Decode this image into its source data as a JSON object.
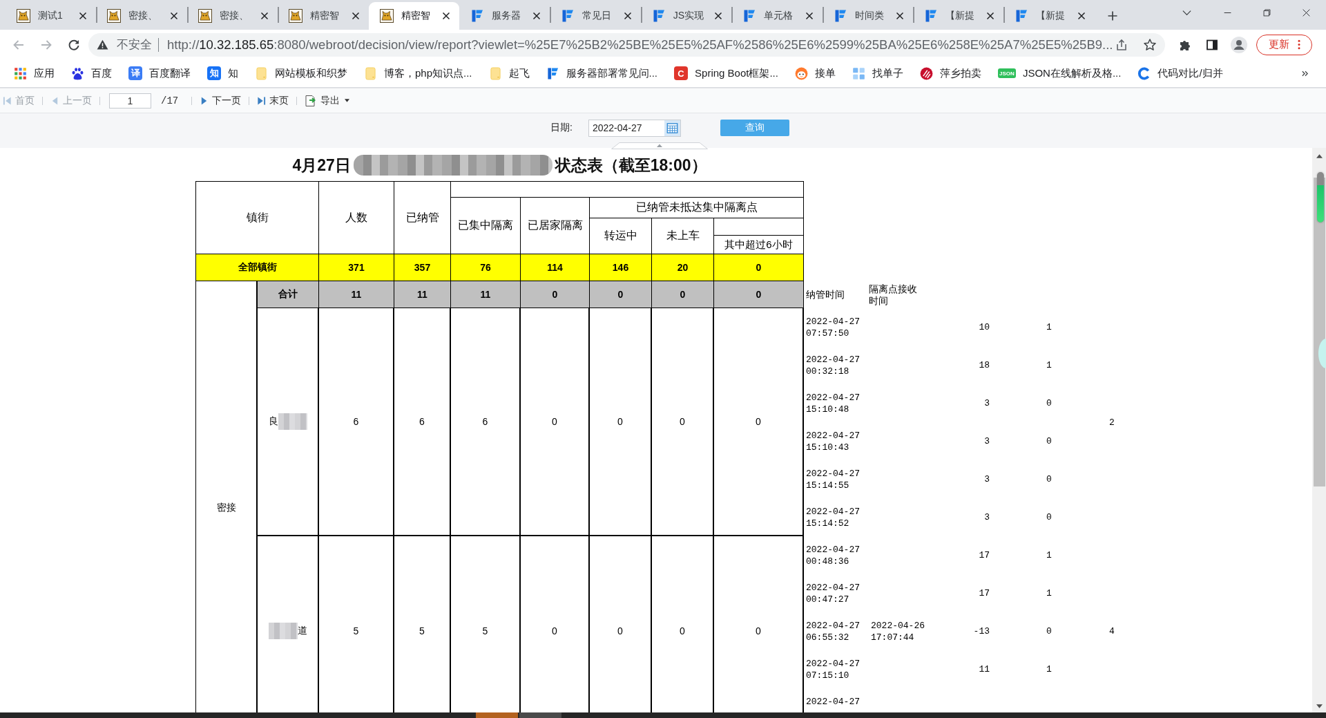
{
  "browser": {
    "tabs": [
      {
        "kind": "cat",
        "title": "测试1",
        "selected": false
      },
      {
        "kind": "cat",
        "title": "密接、",
        "selected": false
      },
      {
        "kind": "cat",
        "title": "密接、",
        "selected": false
      },
      {
        "kind": "cat",
        "title": "精密智",
        "selected": false
      },
      {
        "kind": "cat",
        "title": "精密智",
        "selected": true
      },
      {
        "kind": "report",
        "title": "服务器",
        "selected": false
      },
      {
        "kind": "report",
        "title": "常见日",
        "selected": false
      },
      {
        "kind": "report",
        "title": "JS实现",
        "selected": false
      },
      {
        "kind": "report",
        "title": "单元格",
        "selected": false
      },
      {
        "kind": "report",
        "title": "时间类",
        "selected": false
      },
      {
        "kind": "report",
        "title": "【新提",
        "selected": false
      },
      {
        "kind": "report",
        "title": "【新提",
        "selected": false
      }
    ],
    "nav": {
      "back_disabled": true,
      "forward_disabled": true
    },
    "address": {
      "security_label": "不安全",
      "url_scheme": "http://",
      "url_host": "10.32.185.65",
      "url_rest": ":8080/webroot/decision/view/report?viewlet=%25E7%25B2%25BE%25E5%25AF%2586%25E6%2599%25BA%25E6%258E%25A7%25E5%25B9..."
    },
    "update_button": "更新",
    "bookmarks": [
      {
        "kind": "apps",
        "label": "应用"
      },
      {
        "kind": "paw",
        "label": "百度"
      },
      {
        "kind": "letter",
        "badge": "译",
        "color": "#3b7cf5",
        "label": "百度翻译"
      },
      {
        "kind": "letter",
        "badge": "知",
        "color": "#1772f6",
        "label": "知"
      },
      {
        "kind": "folder",
        "label": "网站模板和织梦"
      },
      {
        "kind": "folder",
        "label": "博客，php知识点..."
      },
      {
        "kind": "folder",
        "label": "起飞"
      },
      {
        "kind": "logo",
        "label": "服务器部署常见问..."
      },
      {
        "kind": "letter",
        "badge": "C",
        "color": "#e0352b",
        "label": "Spring Boot框架..."
      },
      {
        "kind": "face",
        "label": "接单"
      },
      {
        "kind": "tiles",
        "label": "找单子"
      },
      {
        "kind": "stripes",
        "label": "萍乡拍卖"
      },
      {
        "kind": "tag",
        "badge": "JSON",
        "label": "JSON在线解析及格..."
      },
      {
        "kind": "ring",
        "label": "代码对比/归并"
      }
    ]
  },
  "report_toolbar": {
    "nav_before": [
      {
        "kind": "first",
        "label": "首页",
        "disabled": true
      },
      {
        "kind": "prev",
        "label": "上一页",
        "disabled": true
      }
    ],
    "page_field": {
      "value": "1"
    },
    "page_total": "/17",
    "nav_after": [
      {
        "kind": "next",
        "label": "下一页",
        "disabled": false
      },
      {
        "kind": "last",
        "label": "末页",
        "disabled": false
      },
      {
        "kind": "export",
        "label": "导出",
        "disabled": false
      }
    ]
  },
  "parameters": {
    "date_label": "日期:",
    "date_value": "2022-04-27",
    "query_button": "查询"
  },
  "report": {
    "title_start": "4月27日",
    "title_end": "状态表（截至18:00）",
    "header": {
      "district": "镇街",
      "people": "人数",
      "managed": "已纳管",
      "centralized": "已集中隔离",
      "home": "已居家隔离",
      "not_arrived": "已纳管未抵达集中隔离点",
      "in_transit": "转运中",
      "not_boarded": "未上车",
      "over_6h": "其中超过6小时"
    },
    "total_row": {
      "label": "全部镇街",
      "values": [
        "371",
        "357",
        "76",
        "114",
        "146",
        "20",
        "0"
      ]
    },
    "group": {
      "label": "密接",
      "subtotal": {
        "label": "合计",
        "values": [
          "11",
          "11",
          "11",
          "0",
          "0",
          "0",
          "0"
        ]
      },
      "side_header": {
        "managed_time": "纳管时间",
        "received_time": "隔离点接收时间"
      },
      "streets": [
        {
          "name_start": "良",
          "values": [
            "6",
            "6",
            "6",
            "0",
            "0",
            "0",
            "0"
          ],
          "column_5": "2",
          "records": [
            {
              "managed_time": "2022-04-27 07:57:50",
              "column_3": "10",
              "column_4": "1"
            },
            {
              "managed_time": "2022-04-27 00:32:18",
              "column_3": "18",
              "column_4": "1"
            },
            {
              "managed_time": "2022-04-27 15:10:48",
              "column_3": "3",
              "column_4": "0"
            },
            {
              "managed_time": "2022-04-27 15:10:43",
              "column_3": "3",
              "column_4": "0"
            },
            {
              "managed_time": "2022-04-27 15:14:55",
              "column_3": "3",
              "column_4": "0"
            },
            {
              "managed_time": "2022-04-27 15:14:52",
              "column_3": "3",
              "column_4": "0"
            }
          ]
        },
        {
          "name_end": "道",
          "values": [
            "5",
            "5",
            "5",
            "0",
            "0",
            "0",
            "0"
          ],
          "column_5": "4",
          "records": [
            {
              "managed_time": "2022-04-27 00:48:36",
              "column_3": "17",
              "column_4": "1"
            },
            {
              "managed_time": "2022-04-27 00:47:27",
              "column_3": "17",
              "column_4": "1"
            },
            {
              "managed_time": "2022-04-27 06:55:32",
              "received_time": "2022-04-26 17:07:44",
              "column_3": "-13",
              "column_4": "0"
            },
            {
              "managed_time": "2022-04-27 07:15:10",
              "column_3": "11",
              "column_4": "1"
            },
            {
              "managed_time": "2022-04-27"
            }
          ]
        }
      ]
    }
  },
  "overlay_meter": {
    "level": 0.74
  }
}
